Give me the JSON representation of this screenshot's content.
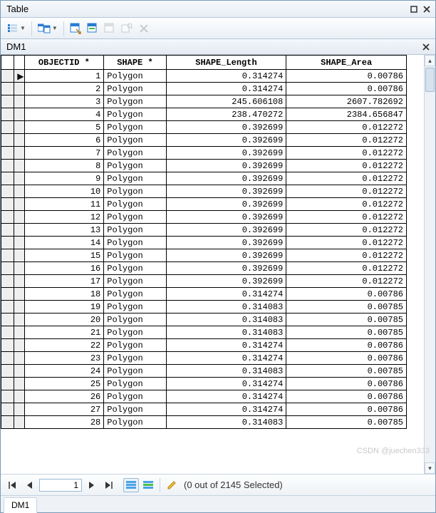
{
  "window": {
    "title": "Table"
  },
  "sub": {
    "title": "DM1"
  },
  "columns": {
    "oid": "OBJECTID *",
    "shape": "SHAPE *",
    "len": "SHAPE_Length",
    "area": "SHAPE_Area"
  },
  "rows": [
    {
      "oid": "1",
      "shape": "Polygon",
      "len": "0.314274",
      "area": "0.00786"
    },
    {
      "oid": "2",
      "shape": "Polygon",
      "len": "0.314274",
      "area": "0.00786"
    },
    {
      "oid": "3",
      "shape": "Polygon",
      "len": "245.606108",
      "area": "2607.782692"
    },
    {
      "oid": "4",
      "shape": "Polygon",
      "len": "238.470272",
      "area": "2384.656847"
    },
    {
      "oid": "5",
      "shape": "Polygon",
      "len": "0.392699",
      "area": "0.012272"
    },
    {
      "oid": "6",
      "shape": "Polygon",
      "len": "0.392699",
      "area": "0.012272"
    },
    {
      "oid": "7",
      "shape": "Polygon",
      "len": "0.392699",
      "area": "0.012272"
    },
    {
      "oid": "8",
      "shape": "Polygon",
      "len": "0.392699",
      "area": "0.012272"
    },
    {
      "oid": "9",
      "shape": "Polygon",
      "len": "0.392699",
      "area": "0.012272"
    },
    {
      "oid": "10",
      "shape": "Polygon",
      "len": "0.392699",
      "area": "0.012272"
    },
    {
      "oid": "11",
      "shape": "Polygon",
      "len": "0.392699",
      "area": "0.012272"
    },
    {
      "oid": "12",
      "shape": "Polygon",
      "len": "0.392699",
      "area": "0.012272"
    },
    {
      "oid": "13",
      "shape": "Polygon",
      "len": "0.392699",
      "area": "0.012272"
    },
    {
      "oid": "14",
      "shape": "Polygon",
      "len": "0.392699",
      "area": "0.012272"
    },
    {
      "oid": "15",
      "shape": "Polygon",
      "len": "0.392699",
      "area": "0.012272"
    },
    {
      "oid": "16",
      "shape": "Polygon",
      "len": "0.392699",
      "area": "0.012272"
    },
    {
      "oid": "17",
      "shape": "Polygon",
      "len": "0.392699",
      "area": "0.012272"
    },
    {
      "oid": "18",
      "shape": "Polygon",
      "len": "0.314274",
      "area": "0.00786"
    },
    {
      "oid": "19",
      "shape": "Polygon",
      "len": "0.314083",
      "area": "0.00785"
    },
    {
      "oid": "20",
      "shape": "Polygon",
      "len": "0.314083",
      "area": "0.00785"
    },
    {
      "oid": "21",
      "shape": "Polygon",
      "len": "0.314083",
      "area": "0.00785"
    },
    {
      "oid": "22",
      "shape": "Polygon",
      "len": "0.314274",
      "area": "0.00786"
    },
    {
      "oid": "23",
      "shape": "Polygon",
      "len": "0.314274",
      "area": "0.00786"
    },
    {
      "oid": "24",
      "shape": "Polygon",
      "len": "0.314083",
      "area": "0.00785"
    },
    {
      "oid": "25",
      "shape": "Polygon",
      "len": "0.314274",
      "area": "0.00786"
    },
    {
      "oid": "26",
      "shape": "Polygon",
      "len": "0.314274",
      "area": "0.00786"
    },
    {
      "oid": "27",
      "shape": "Polygon",
      "len": "0.314274",
      "area": "0.00786"
    },
    {
      "oid": "28",
      "shape": "Polygon",
      "len": "0.314083",
      "area": "0.00785"
    }
  ],
  "nav": {
    "record": "1",
    "status": "(0 out of 2145 Selected)"
  },
  "tab": {
    "label": "DM1"
  },
  "watermark": "CSDN @juechen333"
}
